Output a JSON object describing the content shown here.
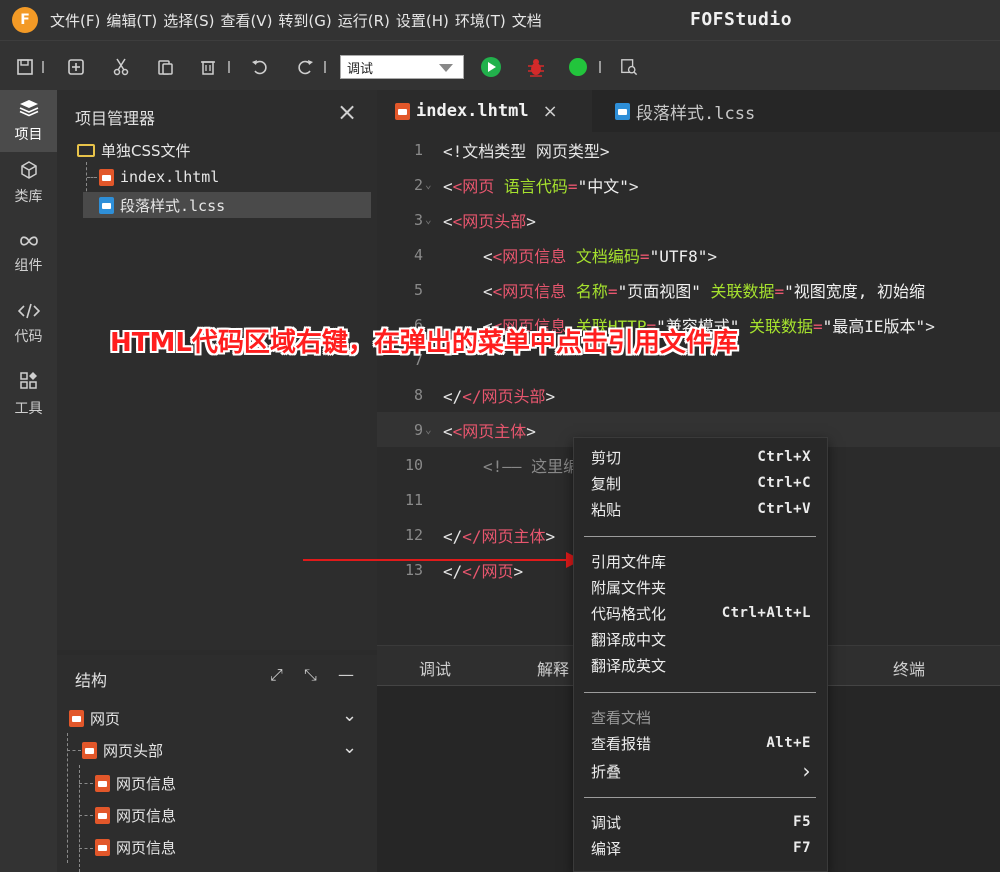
{
  "menu": {
    "items": [
      "文件(F)",
      "编辑(T)",
      "选择(S)",
      "查看(V)",
      "转到(G)",
      "运行(R)",
      "设置(H)",
      "环境(T)",
      "文档"
    ],
    "app_title": "FOFStudio",
    "logo_letter": "F"
  },
  "toolbar": {
    "mode_value": "调试",
    "icons": [
      "save-icon",
      "new-file-icon",
      "cut-icon",
      "paste-icon",
      "delete-icon",
      "undo-icon",
      "redo-icon",
      "run-icon",
      "debug-icon",
      "record-icon",
      "preview-icon"
    ],
    "colors": {
      "run": "#22b14c",
      "debug": "#d42a2a",
      "record": "#22c43c"
    }
  },
  "activity": {
    "items": [
      {
        "label": "项目",
        "icon": "layers-icon"
      },
      {
        "label": "类库",
        "icon": "cube-icon"
      },
      {
        "label": "组件",
        "icon": "infinity-icon"
      },
      {
        "label": "代码",
        "icon": "code-icon"
      },
      {
        "label": "工具",
        "icon": "tools-icon"
      }
    ]
  },
  "explorer": {
    "title": "项目管理器",
    "folder": "单独CSS文件",
    "files": [
      "index.lhtml",
      "段落样式.lcss"
    ]
  },
  "structure": {
    "title": "结构",
    "nodes": [
      "网页",
      "网页头部",
      "网页信息",
      "网页信息",
      "网页信息"
    ]
  },
  "tabs": {
    "active": "index.lhtml",
    "inactive": "段落样式.lcss"
  },
  "editor": {
    "line_numbers": [
      "1",
      "2",
      "3",
      "4",
      "5",
      "6",
      "7",
      "8",
      "9",
      "10",
      "11",
      "12",
      "13"
    ],
    "lines": {
      "l1": {
        "p1": "<!文档类型 网页类型>"
      },
      "l2": {
        "tag": "<网页",
        "attr": " 语言代码",
        "eq": "=",
        "val": "\"中文\"",
        "end": ">"
      },
      "l3": {
        "tag": "<网页头部",
        "end": ">"
      },
      "l4": {
        "tag": "<网页信息",
        "attr": " 文档编码",
        "eq": "=",
        "val": "\"UTF8\"",
        "end": ">"
      },
      "l5": {
        "tag": "<网页信息",
        "attr": " 名称",
        "eq": "=",
        "val": "\"页面视图\"",
        "attr2": " 关联数据",
        "eq2": "=",
        "val2": "\"视图宽度, 初始缩"
      },
      "l6": {
        "tag": "<网页信息",
        "attr": " 关联HTTP",
        "eq": "=",
        "val": "\"兼容模式\"",
        "attr2": " 关联数据",
        "eq2": "=",
        "val2": "\"最高IE版本\"",
        "end": ">"
      },
      "l8": {
        "tag": "</网页头部",
        "end": ">"
      },
      "l9": {
        "tag": "<网页主体",
        "end": ">"
      },
      "l10": {
        "comment": "<!—— 这里编"
      },
      "l12": {
        "tag": "</网页主体",
        "end": ">"
      },
      "l13": {
        "tag": "</网页",
        "end": ">"
      }
    }
  },
  "bottom_tabs": [
    "调试",
    "解释",
    "终端"
  ],
  "context_menu": {
    "group1": [
      {
        "label": "剪切",
        "shortcut": "Ctrl+X"
      },
      {
        "label": "复制",
        "shortcut": "Ctrl+C"
      },
      {
        "label": "粘贴",
        "shortcut": "Ctrl+V"
      }
    ],
    "group2": [
      {
        "label": "引用文件库",
        "shortcut": ""
      },
      {
        "label": "附属文件夹",
        "shortcut": ""
      },
      {
        "label": "代码格式化",
        "shortcut": "Ctrl+Alt+L"
      },
      {
        "label": "翻译成中文",
        "shortcut": ""
      },
      {
        "label": "翻译成英文",
        "shortcut": ""
      }
    ],
    "group3": [
      {
        "label": "查看文档",
        "shortcut": ""
      },
      {
        "label": "查看报错",
        "shortcut": "Alt+E"
      },
      {
        "label": "折叠",
        "shortcut": "›"
      }
    ],
    "group4": [
      {
        "label": "调试",
        "shortcut": "F5"
      },
      {
        "label": "编译",
        "shortcut": "F7"
      }
    ]
  },
  "annotation": {
    "text": "HTML代码区域右键，在弹出的菜单中点击引用文件库",
    "color": "#ff1e1e"
  }
}
